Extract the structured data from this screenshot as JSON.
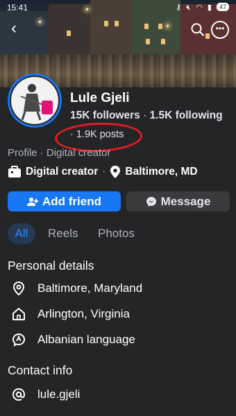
{
  "status_bar": {
    "time": "15:41",
    "battery": "47"
  },
  "profile": {
    "name": "Lule Gjeli",
    "followers": "15K followers",
    "following": "1.5K following",
    "posts": "1.9K posts",
    "category_line": "Profile · Digital creator",
    "detail_category": "Digital creator",
    "detail_location": "Baltimore, MD"
  },
  "actions": {
    "add_friend": "Add friend",
    "message": "Message"
  },
  "tabs": [
    {
      "label": "All",
      "active": true
    },
    {
      "label": "Reels",
      "active": false
    },
    {
      "label": "Photos",
      "active": false
    }
  ],
  "personal_details": {
    "title": "Personal details",
    "items": [
      {
        "icon": "location-pin-icon",
        "text": "Baltimore, Maryland"
      },
      {
        "icon": "home-icon",
        "text": "Arlington, Virginia"
      },
      {
        "icon": "language-icon",
        "text": "Albanian language"
      }
    ]
  },
  "contact_info": {
    "title": "Contact info",
    "items": [
      {
        "icon": "at-sign-icon",
        "text": "lule.gjeli"
      }
    ]
  },
  "colors": {
    "accent": "#1877f2",
    "background": "#242527",
    "annotation_circle": "#e41b23"
  }
}
